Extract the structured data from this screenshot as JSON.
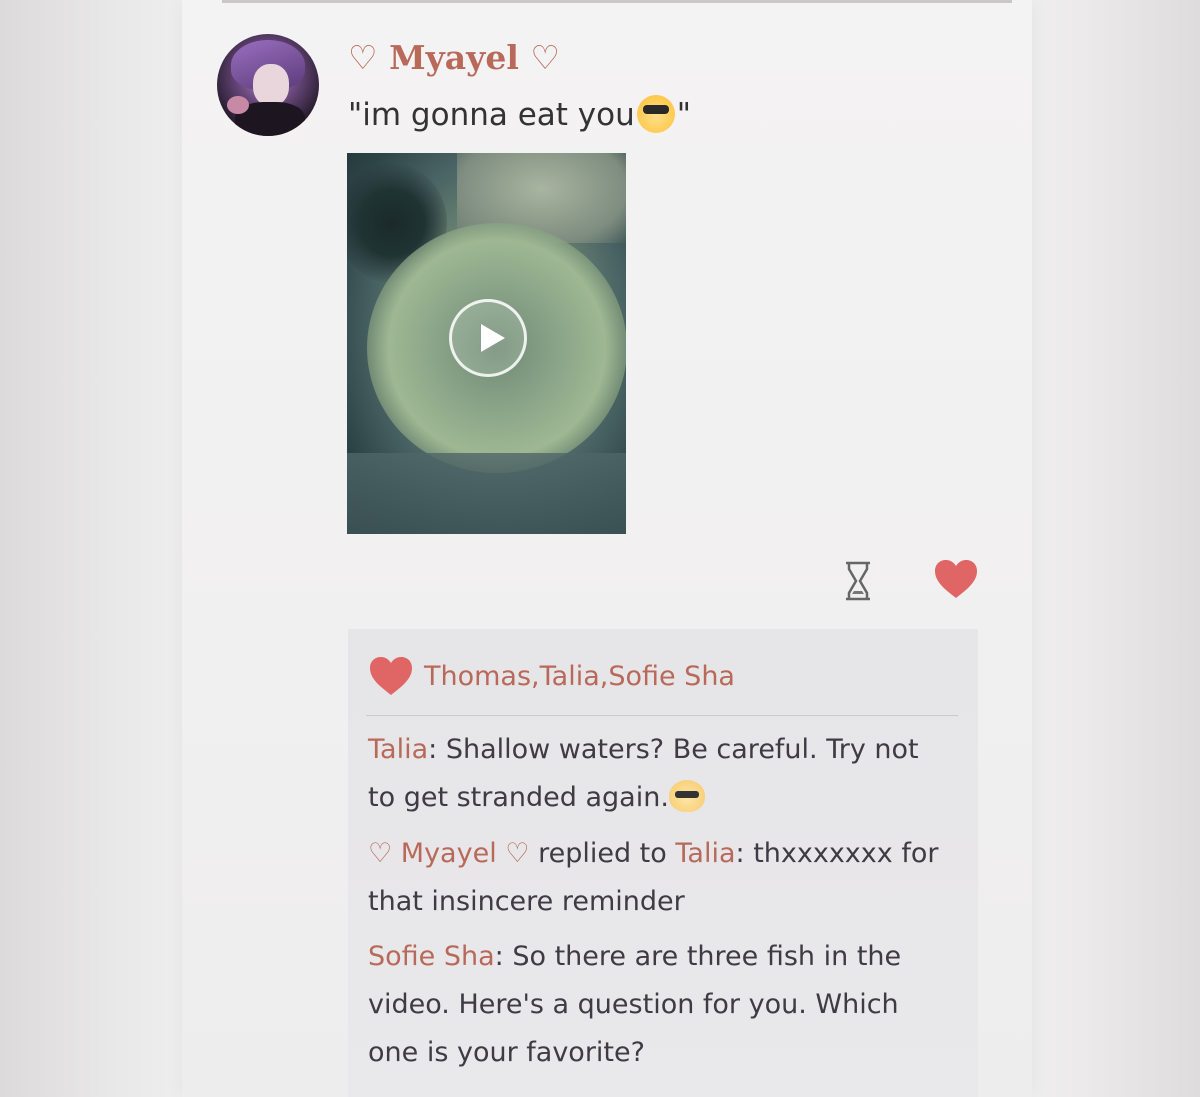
{
  "post": {
    "username": "Myayel",
    "heart_symbol": "♡",
    "text_prefix": "\"im gonna eat you",
    "text_suffix": "\"",
    "emoji": "sunglasses-emoji"
  },
  "media": {
    "type": "video",
    "play_icon": "play-icon"
  },
  "actions": {
    "timer_icon": "hourglass-icon",
    "like_icon": "heart-icon",
    "like_color": "#e06666"
  },
  "likes": {
    "names": "Thomas,Talia,Sofie Sha"
  },
  "comments": [
    {
      "author": "Talia",
      "separator": ": ",
      "text": "Shallow waters? Be careful. Try not to get stranded again.",
      "emoji": "cool-cat-emoji"
    },
    {
      "author_prefix": "♡ Myayel ♡",
      "replied_label": " replied to ",
      "reply_to": "Talia",
      "separator": ": ",
      "text": "thxxxxxxx for that insincere reminder"
    },
    {
      "author": "Sofie Sha",
      "separator": ": ",
      "text": "So there are three fish in the video. Here's a question for you. Which one is your favorite?"
    }
  ],
  "colors": {
    "name_color": "#b9695a",
    "text_color": "#3f3b45",
    "heart_color": "#e06666"
  }
}
